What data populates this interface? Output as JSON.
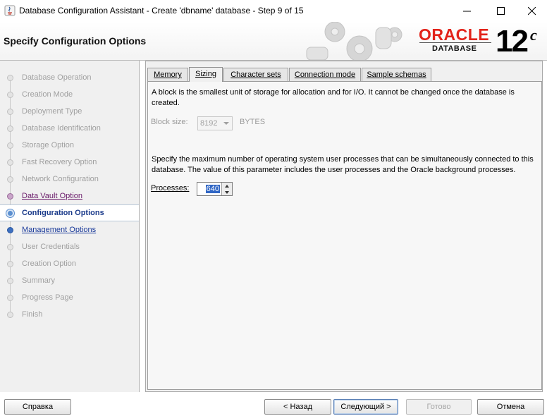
{
  "window": {
    "title": "Database Configuration Assistant - Create 'dbname' database - Step 9 of 15"
  },
  "header": {
    "page_title": "Specify Configuration Options",
    "logo_brand": "ORACLE",
    "logo_product": "DATABASE",
    "logo_version": "12",
    "logo_version_suffix": "c"
  },
  "nav": {
    "items": [
      {
        "label": "Database Operation",
        "state": "disabled"
      },
      {
        "label": "Creation Mode",
        "state": "disabled"
      },
      {
        "label": "Deployment Type",
        "state": "disabled"
      },
      {
        "label": "Database Identification",
        "state": "disabled"
      },
      {
        "label": "Storage Option",
        "state": "disabled"
      },
      {
        "label": "Fast Recovery Option",
        "state": "disabled"
      },
      {
        "label": "Network Configuration",
        "state": "disabled"
      },
      {
        "label": "Data Vault Option",
        "state": "visited"
      },
      {
        "label": "Configuration Options",
        "state": "active"
      },
      {
        "label": "Management Options",
        "state": "link"
      },
      {
        "label": "User Credentials",
        "state": "disabled"
      },
      {
        "label": "Creation Option",
        "state": "disabled"
      },
      {
        "label": "Summary",
        "state": "disabled"
      },
      {
        "label": "Progress Page",
        "state": "disabled"
      },
      {
        "label": "Finish",
        "state": "disabled"
      }
    ]
  },
  "tabs": [
    {
      "label": "Memory",
      "selected": false
    },
    {
      "label": "Sizing",
      "selected": true
    },
    {
      "label": "Character sets",
      "selected": false
    },
    {
      "label": "Connection mode",
      "selected": false
    },
    {
      "label": "Sample schemas",
      "selected": false
    }
  ],
  "sizing": {
    "block_desc_line1": "A block is the smallest unit of storage for allocation and for I/O. It cannot be changed once the database is",
    "block_desc_line2": "created.",
    "block_size_label": "Block size:",
    "block_size_value": "8192",
    "block_size_unit": "BYTES",
    "process_desc_line1": "Specify the maximum number of operating system user processes that can be simultaneously connected to this",
    "process_desc_line2": "database. The value of this parameter includes the user processes and the Oracle background processes.",
    "processes_label": "Processes:",
    "processes_value": "640"
  },
  "buttons": {
    "help": "Справка",
    "back": "< Назад",
    "next": "Следующий >",
    "finish": "Готово",
    "cancel": "Отмена"
  },
  "colors": {
    "oracle_red": "#e2231a",
    "active_step": "#1a3a8a",
    "selection": "#3167c5"
  }
}
